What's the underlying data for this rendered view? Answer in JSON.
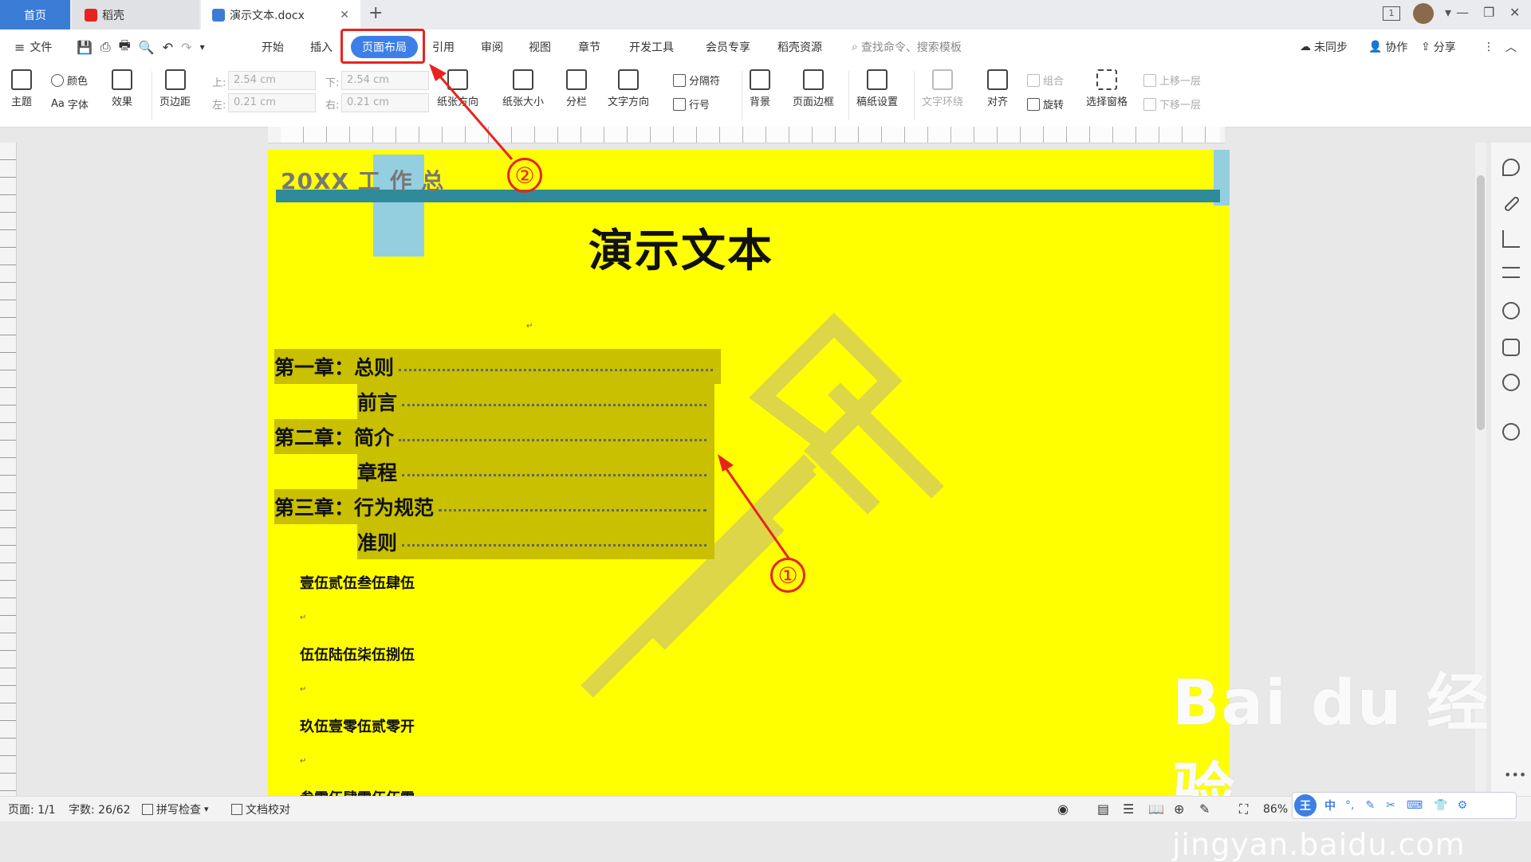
{
  "tabs": {
    "home": "首页",
    "daoke": "稻壳",
    "document": "演示文本.docx",
    "new_tab": "+"
  },
  "window": {
    "pages_icon": "1",
    "min": "—",
    "restore": "❐",
    "close": "✕"
  },
  "menu": {
    "file": "文件",
    "start": "开始",
    "insert": "插入",
    "layout": "页面布局",
    "reference": "引用",
    "review": "审阅",
    "view": "视图",
    "chapter": "章节",
    "devtools": "开发工具",
    "member": "会员专享",
    "daoke_res": "稻壳资源",
    "search": "查找命令、搜索模板",
    "unsync": "未同步",
    "collab": "协作",
    "share": "分享"
  },
  "ribbon": {
    "theme": "主题",
    "color": "颜色",
    "font": "字体",
    "effect": "效果",
    "margin": "页边距",
    "top_label": "上:",
    "top_value": "2.54 cm",
    "bottom_label": "下:",
    "bottom_value": "2.54 cm",
    "left_label": "左:",
    "left_value": "0.21 cm",
    "right_label": "右:",
    "right_value": "0.21 cm",
    "orientation": "纸张方向",
    "size": "纸张大小",
    "columns": "分栏",
    "text_dir": "文字方向",
    "breaks": "分隔符",
    "line_num": "行号",
    "background": "背景",
    "page_border": "页面边框",
    "manuscript": "稿纸设置",
    "wrap": "文字环绕",
    "align": "对齐",
    "group": "组合",
    "rotate": "旋转",
    "select_pane": "选择窗格",
    "bring_forward": "上移一层",
    "send_backward": "下移一层"
  },
  "document": {
    "header_text": "20XX 工 作 总",
    "title": "演示文本",
    "toc": [
      {
        "chapter": "第一章：",
        "title": "总则"
      },
      {
        "chapter": "",
        "title": "前言"
      },
      {
        "chapter": "第二章：",
        "title": "简介"
      },
      {
        "chapter": "",
        "title": "章程"
      },
      {
        "chapter": "第三章：",
        "title": "行为规范"
      },
      {
        "chapter": "",
        "title": "准则"
      }
    ],
    "body_lines": [
      "壹伍贰伍叁伍肆伍",
      "伍伍陆伍柒伍捌伍",
      "玖伍壹零伍贰零开",
      "叁零伍肆零伍伍零"
    ]
  },
  "annotations": {
    "circle1": "①",
    "circle2": "②",
    "annotation_color": "#e8231f"
  },
  "status": {
    "page": "页面: 1/1",
    "words": "字数: 26/62",
    "spell": "拼写检查",
    "proof": "文档校对",
    "zoom": "86%"
  },
  "watermark": {
    "big": "Bai du 经验",
    "small": "jingyan.baidu.com"
  },
  "ime": {
    "label": "中"
  },
  "colors": {
    "page_bg": "#ffff00",
    "accent": "#3d7fe6",
    "teal_bar": "#2f8b99",
    "toc_highlight": "#c8c000"
  }
}
